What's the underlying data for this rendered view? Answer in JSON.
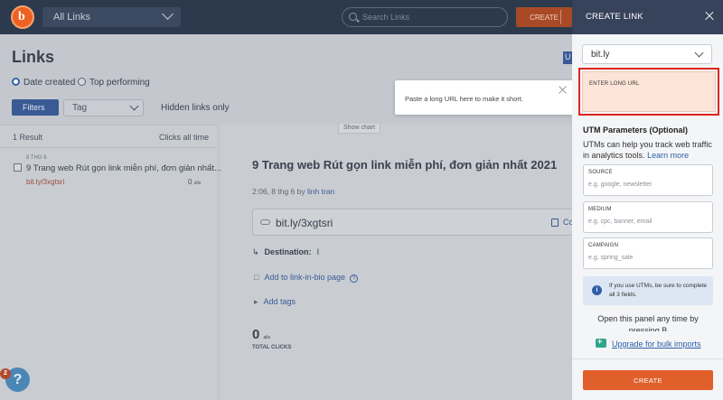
{
  "topbar": {
    "logo_letter": "b",
    "links_dropdown": "All Links",
    "search_placeholder": "Search Links",
    "create_label": "CREATE"
  },
  "page": {
    "title": "Links",
    "sort_options": [
      {
        "label": "Date created",
        "selected": true
      },
      {
        "label": "Top performing",
        "selected": false
      }
    ],
    "filters_label": "Filters",
    "tag_label": "Tag",
    "hidden_links_label": "Hidden links only",
    "edge_badge": "U"
  },
  "list": {
    "result_count": "1 Result",
    "clicks_header": "Clicks all time",
    "items": [
      {
        "date": "8 THG 6",
        "title": "9 Trang web Rút gọn link miễn phí, đơn giản nhất...",
        "short_link": "bit.ly/3xgtsri",
        "clicks": "0",
        "clicks_unit": "alis"
      }
    ]
  },
  "detail": {
    "show_chart": "Show chart",
    "title": "9 Trang web Rút gọn link miễn phí, đơn giản nhất 2021",
    "meta_prefix": "2:06, 8 thg 6 by",
    "meta_user": "linh tran",
    "short_url": "bit.ly/3xgtsri",
    "copy_label": "Co",
    "destination_label": "Destination:",
    "destination_value": "I",
    "add_bio_label": "Add to link-in-bio page",
    "add_tags_label": "Add tags",
    "total_clicks_value": "0",
    "total_clicks_unit": "alis",
    "total_clicks_label": "TOTAL CLICKS"
  },
  "help": {
    "badge": "2",
    "icon_glyph": "?"
  },
  "tooltip": {
    "text": "Paste a long URL here to make it short."
  },
  "panel": {
    "title": "CREATE LINK",
    "domain": "bit.ly",
    "long_url_label": "ENTER LONG URL",
    "utm_heading": "UTM Parameters (Optional)",
    "utm_description": "UTMs can help you track web traffic in analytics tools.",
    "learn_more": "Learn more",
    "fields": [
      {
        "label": "SOURCE",
        "placeholder": "e.g. google, newsletter"
      },
      {
        "label": "MEDIUM",
        "placeholder": "e.g. cpc, banner, email"
      },
      {
        "label": "CAMPAIGN",
        "placeholder": "e.g. spring_sale"
      }
    ],
    "info_icon": "i",
    "info_text": "If you use UTMs, be sure to complete all 3 fields.",
    "open_panel_text": "Open this panel any time by pressing B",
    "bulk_link": "Upgrade for bulk imports",
    "create_button": "CREATE"
  },
  "colors": {
    "accent": "#e15f2b",
    "highlight_border": "#e0241c",
    "link_blue": "#2d5fa8",
    "topbar": "#2d3a4d"
  }
}
